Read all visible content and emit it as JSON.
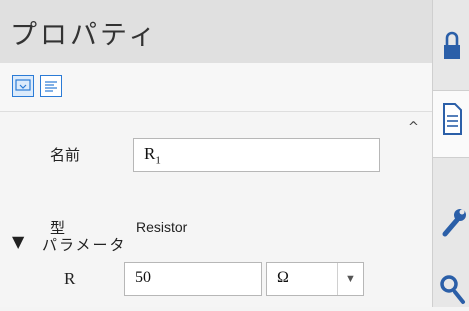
{
  "panel": {
    "title": "プロパティ"
  },
  "toolbar": {
    "buttons": [
      {
        "icon": "dropdown-panel-icon",
        "active": true
      },
      {
        "icon": "text-lines-icon",
        "active": false
      }
    ]
  },
  "properties": {
    "name_label": "名前",
    "name_value": "R",
    "name_subscript": "1",
    "type_label": "型",
    "type_value": "Resistor",
    "section_arrow": "▼",
    "section_label": "パラメータ",
    "param_label": "R",
    "param_value": "50",
    "param_unit": "Ω"
  },
  "scrollbar": {
    "up_arrow": "^"
  },
  "rail": {
    "tabs": [
      {
        "icon": "lock-icon"
      },
      {
        "icon": "document-icon",
        "active": true
      },
      {
        "icon": "wrench-icon"
      },
      {
        "icon": "settings-icon"
      }
    ]
  },
  "colors": {
    "accent": "#2b7bd6",
    "title_bg": "#e0e0e0",
    "panel_bg": "#f5f5f5"
  }
}
